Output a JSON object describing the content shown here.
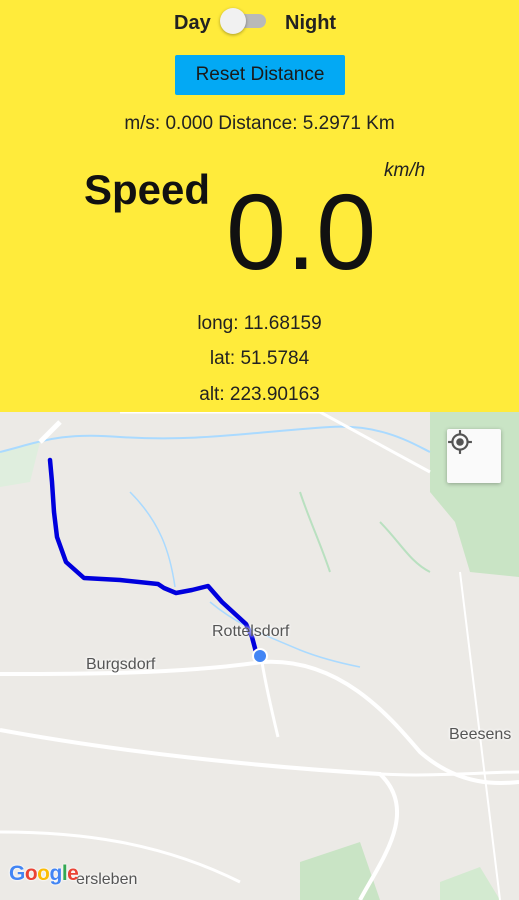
{
  "mode_toggle": {
    "day_label": "Day",
    "night_label": "Night",
    "state": "day"
  },
  "reset_button": {
    "label": "Reset Distance"
  },
  "metrics_line": "m/s: 0.000 Distance: 5.2971 Km",
  "speed": {
    "label": "Speed",
    "value": "0.0",
    "unit": "km/h"
  },
  "coordinates": {
    "long": "long: 11.68159",
    "lat": "lat: 51.5784",
    "alt": "alt: 223.90163"
  },
  "map": {
    "places": {
      "rottelsdorf": "Rottelsdorf",
      "burgsdorf": "Burgsdorf",
      "beesens": "Beesens",
      "sersleben": "ersleben"
    },
    "logo_letters": [
      "G",
      "o",
      "o",
      "g",
      "l",
      "e"
    ],
    "colors": {
      "route": "#0000dd",
      "position_dot": "#4285f4",
      "background": "#eceae6",
      "water": "#aadaff",
      "green": "#c8e6c9"
    }
  },
  "colors": {
    "header_background": "#ffeb3b",
    "button": "#03a9f4"
  },
  "icons": {
    "locate": "my-location-icon"
  }
}
